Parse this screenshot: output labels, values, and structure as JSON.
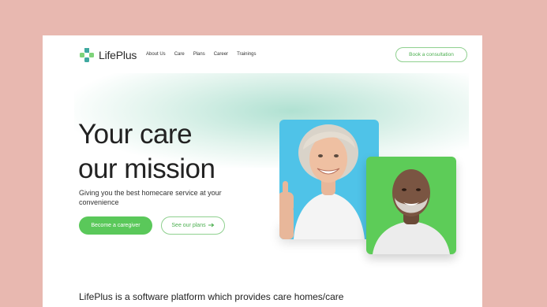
{
  "brand": {
    "name": "LifePlus",
    "accent": "#5ac85a",
    "logo_colors": [
      "#3fa9a0",
      "#7ed37a"
    ]
  },
  "nav": {
    "links": [
      "About Us",
      "Care",
      "Plans",
      "Career",
      "Trainings"
    ],
    "cta": "Book a consultation"
  },
  "hero": {
    "title_line1": "Your care",
    "title_line2": "our mission",
    "subtitle": "Giving you the best homecare service at your convenience",
    "primary_button": "Become a caregiver",
    "secondary_button": "See our plans",
    "secondary_icon": "arrow-right-icon",
    "images": [
      {
        "subject": "older woman smiling with thumbs up",
        "background": "#4fc3e8"
      },
      {
        "subject": "older man smiling",
        "background": "#5dcc58"
      }
    ]
  },
  "about": {
    "text": "LifePlus is a software platform which provides care homes/care"
  }
}
